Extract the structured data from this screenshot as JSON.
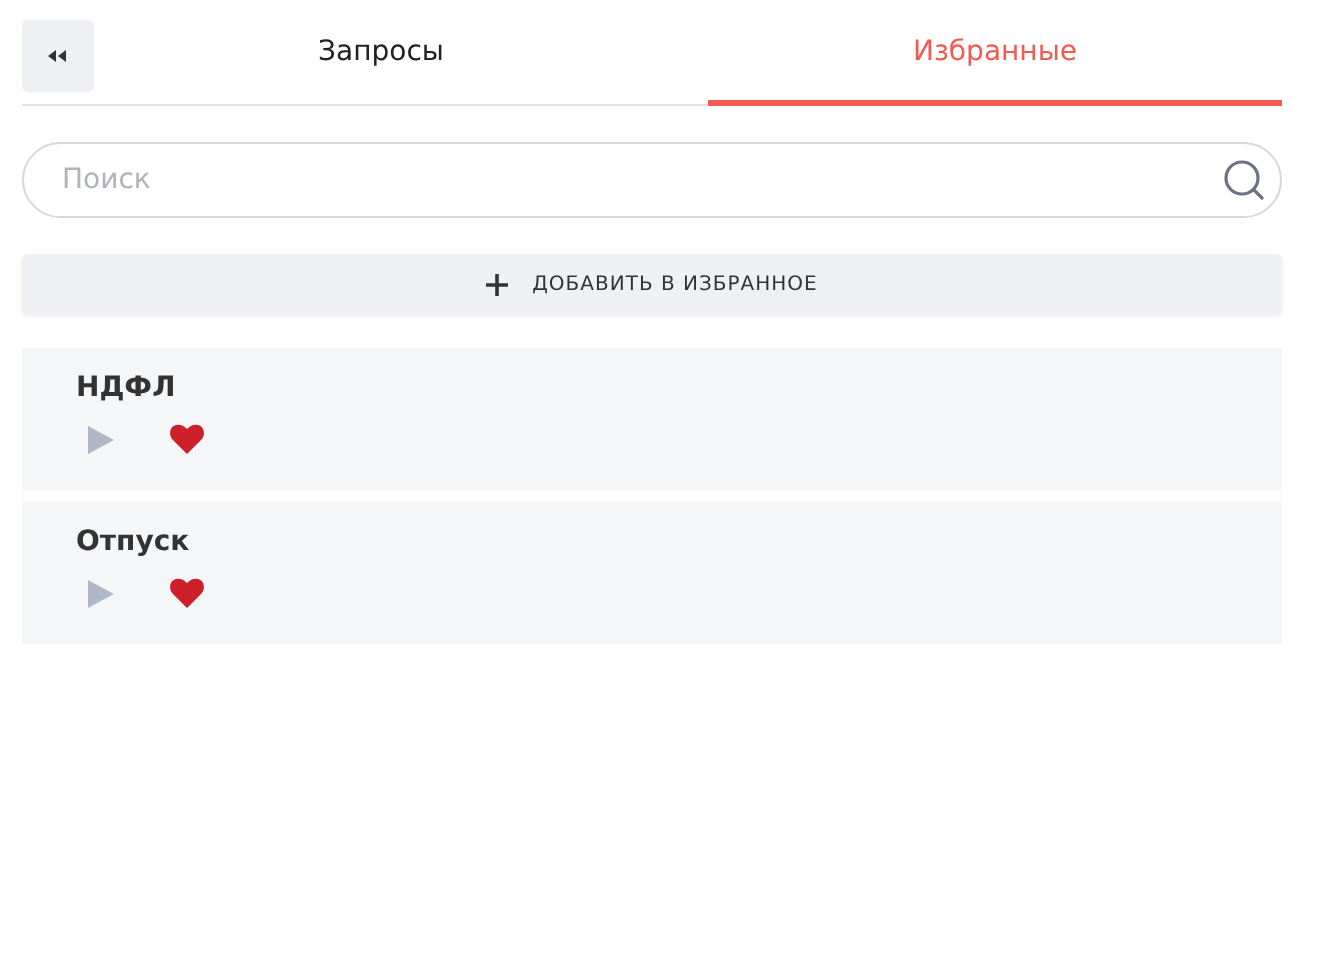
{
  "tabs": [
    {
      "label": "Запросы",
      "selected": false
    },
    {
      "label": "Избранные",
      "selected": true
    }
  ],
  "search": {
    "placeholder": "Поиск"
  },
  "add_button": {
    "label": "ДОБАВИТЬ В ИЗБРАННОЕ"
  },
  "items": [
    {
      "title": "НДФЛ",
      "favorite": true
    },
    {
      "title": "Отпуск",
      "favorite": true
    }
  ]
}
